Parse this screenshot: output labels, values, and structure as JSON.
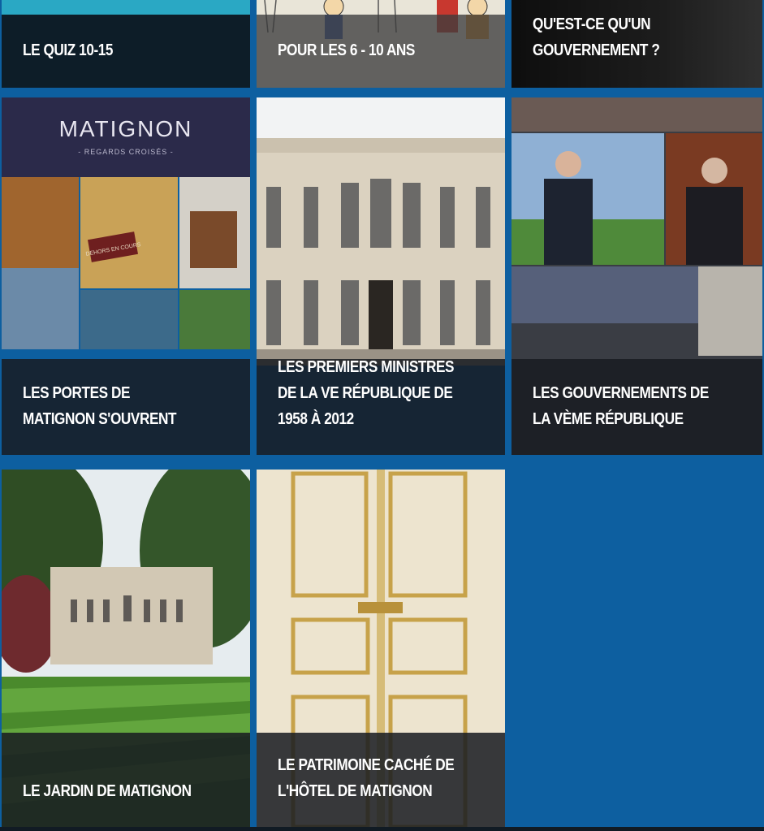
{
  "tiles": [
    {
      "id": "quiz",
      "title": "LE QUIZ 10-15",
      "image": "quiz-10-15-illustration"
    },
    {
      "id": "kids",
      "title": "POUR LES 6 - 10 ANS",
      "image": "children-illustration"
    },
    {
      "id": "gov",
      "title": "QU'EST-CE QU'UN GOUVERNEMENT ?",
      "image": "government-photo"
    },
    {
      "id": "portes",
      "title": "LES PORTES DE MATIGNON S'OUVRENT",
      "image": "matignon-collage",
      "logo_text": "MATIGNON",
      "logo_subtext": "- REGARDS CROISÉS -",
      "sign_text": "DEHORS EN COURS"
    },
    {
      "id": "pm",
      "title": "LES PREMIERS MINISTRES DE LA VE RÉPUBLIQUE DE 1958 À 2012",
      "image": "hotel-de-matignon-facade"
    },
    {
      "id": "govs",
      "title": "LES GOUVERNEMENTS DE LA VÈME RÉPUBLIQUE",
      "image": "presidents-collage"
    },
    {
      "id": "jardin",
      "title": "LE JARDIN DE MATIGNON",
      "image": "matignon-garden"
    },
    {
      "id": "patri",
      "title": "LE PATRIMOINE CACHÉ DE L'HÔTEL DE MATIGNON",
      "image": "gilded-door"
    }
  ],
  "colors": {
    "background": "#0d5fa0",
    "caption": "#181c22"
  }
}
